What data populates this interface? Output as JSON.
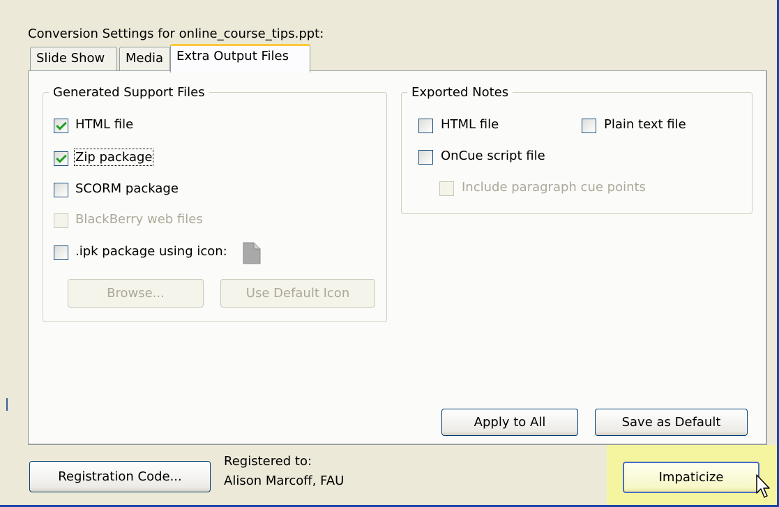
{
  "title": "Conversion Settings for online_course_tips.ppt:",
  "tabs": [
    {
      "label": "Slide Show",
      "active": false
    },
    {
      "label": "Media",
      "active": false
    },
    {
      "label": "Extra Output Files",
      "active": true
    }
  ],
  "generated": {
    "legend": "Generated Support Files",
    "html_file": {
      "label": "HTML file",
      "checked": true
    },
    "zip_package": {
      "label": "Zip package",
      "checked": true
    },
    "scorm_package": {
      "label": "SCORM package",
      "checked": false
    },
    "blackberry": {
      "label": "BlackBerry web files",
      "checked": false,
      "disabled": true
    },
    "ipk": {
      "label": ".ipk package using icon:",
      "checked": false
    },
    "browse_label": "Browse...",
    "default_icon_label": "Use Default Icon"
  },
  "notes": {
    "legend": "Exported Notes",
    "html_file": {
      "label": "HTML file",
      "checked": false
    },
    "plain_text": {
      "label": "Plain text file",
      "checked": false
    },
    "oncue": {
      "label": "OnCue script file",
      "checked": false
    },
    "cue_points": {
      "label": "Include paragraph cue points",
      "checked": false,
      "disabled": true
    }
  },
  "buttons": {
    "apply_all": "Apply to All",
    "save_default": "Save as Default",
    "registration": "Registration Code...",
    "impaticize": "Impaticize"
  },
  "registration": {
    "label": "Registered to:",
    "name": "Alison Marcoff, FAU"
  },
  "colors": {
    "background": "#ece9d8",
    "window_border": "#1b43a8",
    "active_tab_accent": "#ffc83c",
    "check_mark": "#21a121",
    "highlight": "#f5f5a0"
  }
}
